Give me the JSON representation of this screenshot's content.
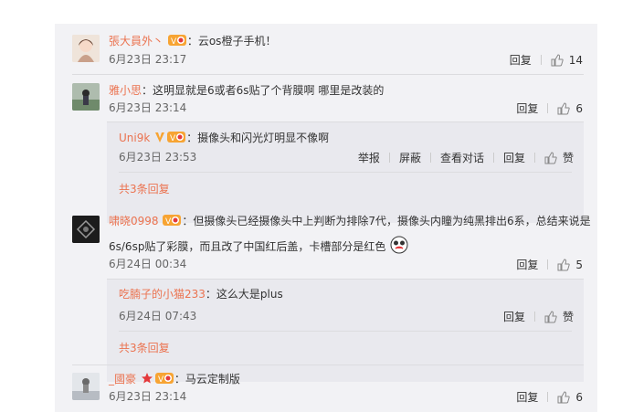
{
  "comments": [
    {
      "author": "張大員外丶",
      "text": "：云os橙子手机！",
      "date": "6月23日 23:17",
      "reply_label": "回复",
      "like_count": "14"
    },
    {
      "author": "雅小思",
      "text": "：这明显就是6或者6s贴了个背膜啊  哪里是改装的",
      "date": "6月23日 23:14",
      "reply_label": "回复",
      "like_count": "6",
      "sub_reply": {
        "author": "Uni9k",
        "text": "：摄像头和闪光灯明显不像啊",
        "date": "6月23日 23:53",
        "actions": [
          "举报",
          "屏蔽",
          "查看对话",
          "回复"
        ],
        "like_label": "赞"
      },
      "more_label": "共3条回复"
    },
    {
      "author": "啸晓0998",
      "text_line1": "：但摄像头已经摄像头中上判断为排除7代，摄像头内瞳为纯黑排出6系，总结来说是",
      "text_line2": "6s/6sp贴了彩膜，而且改了中国红后盖，卡槽部分是红色",
      "date": "6月24日 00:34",
      "reply_label": "回复",
      "like_count": "5",
      "sub_reply": {
        "author": "吃腩子的小猫233",
        "text": "：这么大是plus",
        "date": "6月24日 07:43",
        "actions": [
          "回复"
        ],
        "like_label": "赞"
      },
      "more_label": "共3条回复"
    },
    {
      "author": "_國豪",
      "text": "：马云定制版",
      "date": "6月23日 23:14",
      "reply_label": "回复",
      "like_count": "6"
    }
  ],
  "colors": {
    "name": "#eb7350",
    "badge_orange": "#f7a433",
    "vip_red": "#e4393c"
  }
}
